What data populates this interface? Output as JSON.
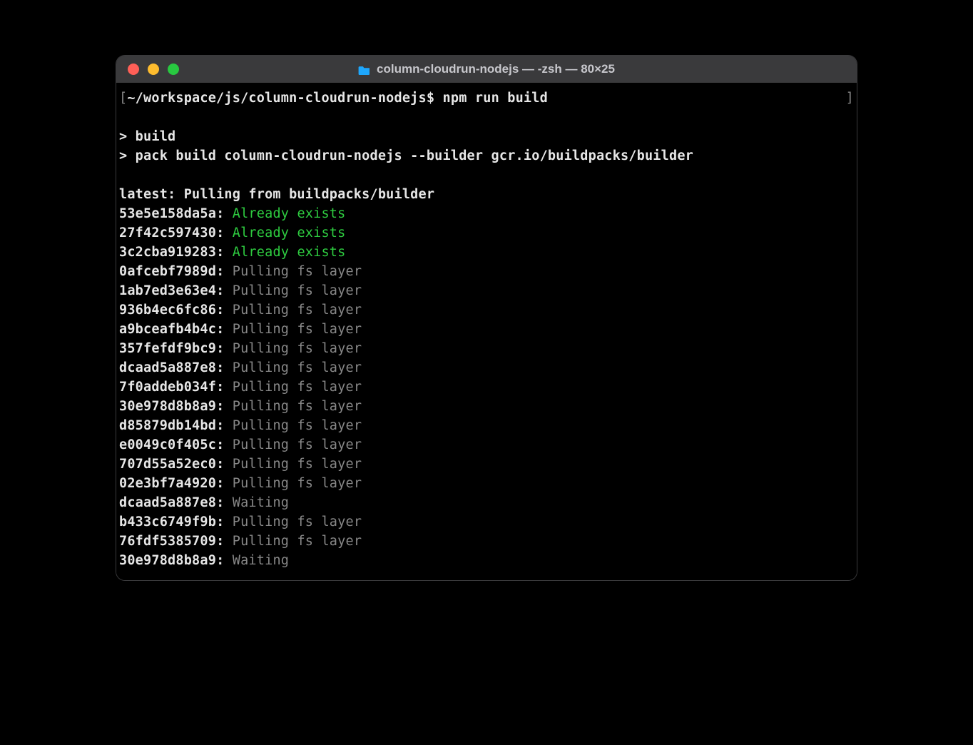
{
  "window": {
    "title": "column-cloudrun-nodejs — -zsh — 80×25"
  },
  "prompt": {
    "open_bracket": "[",
    "path": "~/workspace/js/column-cloudrun-nodejs",
    "sigil": "$",
    "close_bracket": "]",
    "command": "npm run build"
  },
  "script_echo": {
    "l1": "> build",
    "l2": "> pack build column-cloudrun-nodejs --builder gcr.io/buildpacks/builder"
  },
  "pull_header": "latest: Pulling from buildpacks/builder",
  "layers": [
    {
      "hash": "53e5e158da5a",
      "status": "Already exists",
      "kind": "exists"
    },
    {
      "hash": "27f42c597430",
      "status": "Already exists",
      "kind": "exists"
    },
    {
      "hash": "3c2cba919283",
      "status": "Already exists",
      "kind": "exists"
    },
    {
      "hash": "0afcebf7989d",
      "status": "Pulling fs layer",
      "kind": "pull"
    },
    {
      "hash": "1ab7ed3e63e4",
      "status": "Pulling fs layer",
      "kind": "pull"
    },
    {
      "hash": "936b4ec6fc86",
      "status": "Pulling fs layer",
      "kind": "pull"
    },
    {
      "hash": "a9bceafb4b4c",
      "status": "Pulling fs layer",
      "kind": "pull"
    },
    {
      "hash": "357fefdf9bc9",
      "status": "Pulling fs layer",
      "kind": "pull"
    },
    {
      "hash": "dcaad5a887e8",
      "status": "Pulling fs layer",
      "kind": "pull"
    },
    {
      "hash": "7f0addeb034f",
      "status": "Pulling fs layer",
      "kind": "pull"
    },
    {
      "hash": "30e978d8b8a9",
      "status": "Pulling fs layer",
      "kind": "pull"
    },
    {
      "hash": "d85879db14bd",
      "status": "Pulling fs layer",
      "kind": "pull"
    },
    {
      "hash": "e0049c0f405c",
      "status": "Pulling fs layer",
      "kind": "pull"
    },
    {
      "hash": "707d55a52ec0",
      "status": "Pulling fs layer",
      "kind": "pull"
    },
    {
      "hash": "02e3bf7a4920",
      "status": "Pulling fs layer",
      "kind": "pull"
    },
    {
      "hash": "dcaad5a887e8",
      "status": "Waiting",
      "kind": "wait"
    },
    {
      "hash": "b433c6749f9b",
      "status": "Pulling fs layer",
      "kind": "pull"
    },
    {
      "hash": "76fdf5385709",
      "status": "Pulling fs layer",
      "kind": "pull"
    },
    {
      "hash": "30e978d8b8a9",
      "status": "Waiting",
      "kind": "wait"
    }
  ]
}
